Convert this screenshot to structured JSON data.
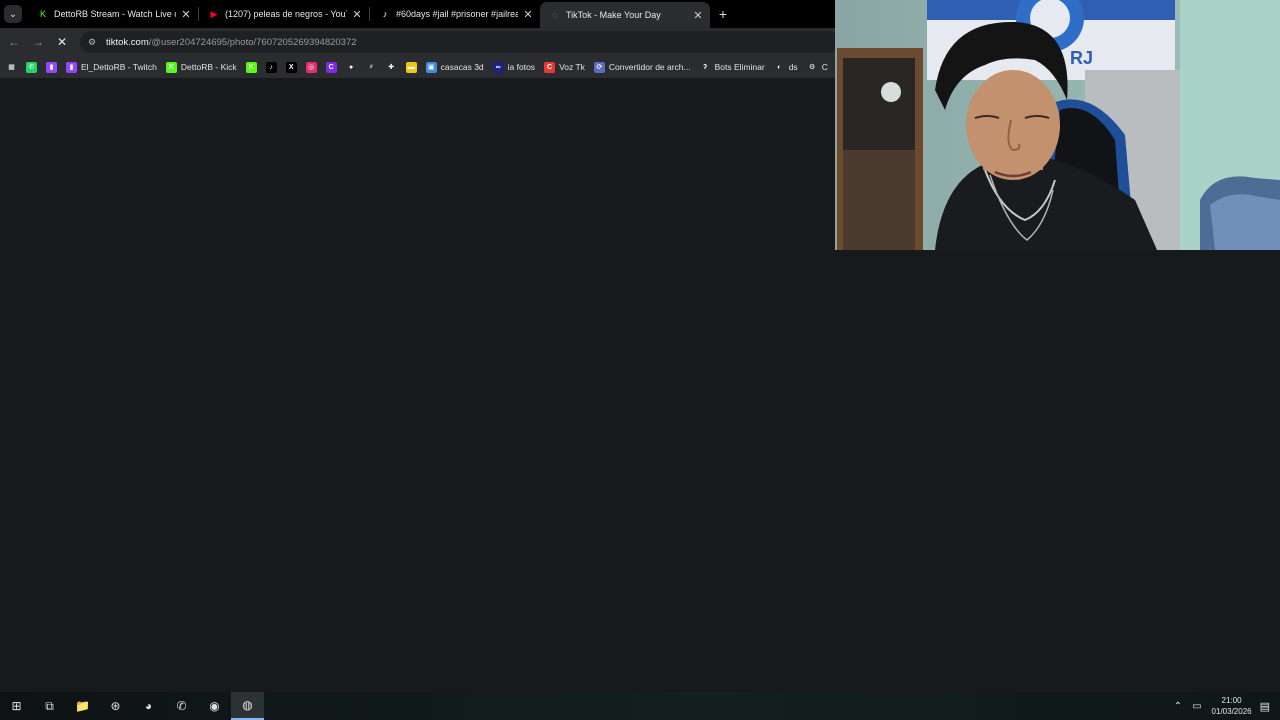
{
  "tabs": [
    {
      "title": "DettoRB Stream - Watch Live o",
      "icon": "kick-icon",
      "color": "#53fc18",
      "glyph": "K",
      "active": false
    },
    {
      "title": "(1207) peleas de negros - YouT",
      "icon": "youtube-icon",
      "color": "#ff0033",
      "glyph": "▶",
      "active": false
    },
    {
      "title": "#60days #jail #prisoner #jailrea",
      "icon": "tiktok-icon",
      "color": "#ffffff",
      "glyph": "♪",
      "active": false
    },
    {
      "title": "TikTok - Make Your Day",
      "icon": "loading-icon",
      "color": "#9aa0a6",
      "glyph": "◌",
      "active": true
    }
  ],
  "toolbar": {
    "url_host": "tiktok.com",
    "url_path": "/@user204724695/photo/7607205269394820372"
  },
  "bookmarks": [
    {
      "label": "",
      "icon": "apps-grid-icon",
      "color": "#2b2c2f",
      "glyph": "▦"
    },
    {
      "label": "",
      "icon": "whatsapp-icon",
      "color": "#25d366",
      "glyph": "✆"
    },
    {
      "label": "",
      "icon": "twitch-icon",
      "color": "#9146ff",
      "glyph": "▮"
    },
    {
      "label": "El_DettoRB - Twitch",
      "icon": "twitch-icon",
      "color": "#9146ff",
      "glyph": "▮"
    },
    {
      "label": "DettoRB - Kick",
      "icon": "kick-icon",
      "color": "#53fc18",
      "glyph": "K"
    },
    {
      "label": "",
      "icon": "kick-icon",
      "color": "#53fc18",
      "glyph": "K"
    },
    {
      "label": "",
      "icon": "tiktok-icon",
      "color": "#000000",
      "glyph": "♪"
    },
    {
      "label": "",
      "icon": "x-icon",
      "color": "#000000",
      "glyph": "X"
    },
    {
      "label": "",
      "icon": "instagram-icon",
      "color": "#e1306c",
      "glyph": "◎"
    },
    {
      "label": "",
      "icon": "canva-icon",
      "color": "#7d2ae8",
      "glyph": "C"
    },
    {
      "label": "",
      "icon": "music-icon",
      "color": "#2b2c2f",
      "glyph": "●"
    },
    {
      "label": "",
      "icon": "bolt-icon",
      "color": "#2b2c2f",
      "glyph": "⚡"
    },
    {
      "label": "",
      "icon": "slack-icon",
      "color": "#2b2c2f",
      "glyph": "✚"
    },
    {
      "label": "",
      "icon": "chat-icon",
      "color": "#f0c419",
      "glyph": "▬"
    },
    {
      "label": "casacas 3d",
      "icon": "image-icon",
      "color": "#3c8dde",
      "glyph": "▣"
    },
    {
      "label": "ia fotos",
      "icon": "ai-icon",
      "color": "#1a237e",
      "glyph": "∞"
    },
    {
      "label": "Voz Tk",
      "icon": "voice-icon",
      "color": "#e53935",
      "glyph": "C"
    },
    {
      "label": "Convertidor de arch...",
      "icon": "converter-icon",
      "color": "#5c6bc0",
      "glyph": "⟳"
    },
    {
      "label": "Bots Eliminar",
      "icon": "bot-icon",
      "color": "#2b2c2f",
      "glyph": "ʔ"
    },
    {
      "label": "ds",
      "icon": "ds-icon",
      "color": "#2b2c2f",
      "glyph": "◐"
    },
    {
      "label": "C",
      "icon": "settings-icon",
      "color": "#2b2c2f",
      "glyph": "⚙"
    }
  ],
  "taskbar": {
    "apps": [
      {
        "icon": "windows-start-icon",
        "glyph": "⊞"
      },
      {
        "icon": "task-view-icon",
        "glyph": "⧉"
      },
      {
        "icon": "file-explorer-icon",
        "glyph": "📁"
      },
      {
        "icon": "app-red-icon",
        "glyph": "⊛"
      },
      {
        "icon": "discord-icon",
        "glyph": "◕"
      },
      {
        "icon": "whatsapp-icon",
        "glyph": "✆"
      },
      {
        "icon": "obs-icon",
        "glyph": "◉"
      },
      {
        "icon": "chrome-icon",
        "glyph": "◍"
      }
    ],
    "time": "21:00",
    "date": "01/03/2026"
  }
}
